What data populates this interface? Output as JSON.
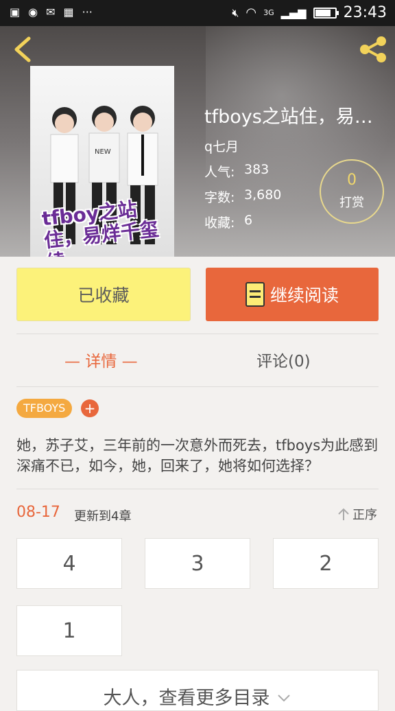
{
  "status_bar": {
    "time": "23:43",
    "network": "3G",
    "battery_level": 0.75
  },
  "book": {
    "title": "tfboys之站住，易烊千玺续",
    "author": "q七月",
    "stats": [
      {
        "label": "人气:",
        "value": "383"
      },
      {
        "label": "字数:",
        "value": "3,680"
      },
      {
        "label": "收藏:",
        "value": "6"
      }
    ],
    "cover_text": "tfboy之站住，易烊千玺续"
  },
  "tip": {
    "count": "0",
    "label": "打赏"
  },
  "actions": {
    "favorited_label": "已收藏",
    "continue_label": "继续阅读"
  },
  "tabs": {
    "detail": "— 详情 —",
    "comments": "评论(0)"
  },
  "tags": [
    "TFBOYS"
  ],
  "add_tag_symbol": "+",
  "description": "她，苏子艾，三年前的一次意外而死去，tfboys为此感到深痛不已，如今，她，回来了，她将如何选择？",
  "update": {
    "date": "08-17",
    "text": "更新到4章"
  },
  "sort_label": "正序",
  "chapters": [
    "4",
    "3",
    "2",
    "1"
  ],
  "more_label": "大人，查看更多目录",
  "colors": {
    "accent": "#e8673c",
    "favorite_bg": "#fcf27a",
    "tag_bg": "#f4a940"
  },
  "icons": [
    "back-arrow-icon",
    "share-icon",
    "book-icon",
    "sort-arrow-icon",
    "chevron-down-icon"
  ]
}
